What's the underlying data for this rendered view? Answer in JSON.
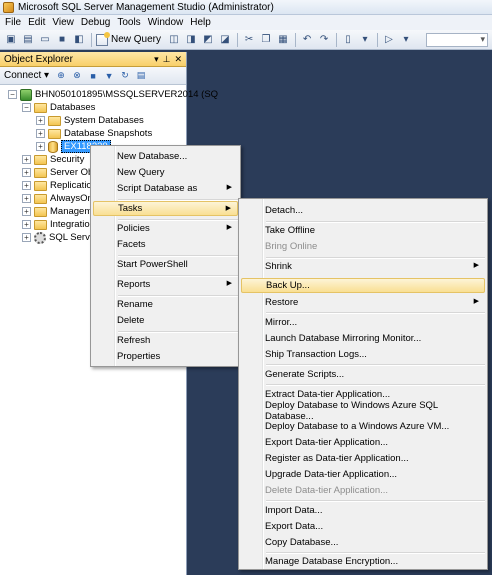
{
  "window": {
    "title": "Microsoft SQL Server Management Studio (Administrator)"
  },
  "menubar": {
    "items": [
      "File",
      "Edit",
      "View",
      "Debug",
      "Tools",
      "Window",
      "Help"
    ]
  },
  "toolbar": {
    "new_query_label": "New Query"
  },
  "object_explorer": {
    "title": "Object Explorer",
    "connect_label": "Connect ▾",
    "tree": {
      "server": "BHN050101895\\MSSQLSERVER2014 (SQ",
      "databases": "Databases",
      "system_databases": "System Databases",
      "database_snapshots": "Database Snapshots",
      "selected_db": "EX118230",
      "security": "Security",
      "server_objects": "Server Obje",
      "replication": "Replication",
      "alwayson": "AlwaysOn",
      "management": "Manageme",
      "integration": "Integration",
      "agent": "SQL Server"
    }
  },
  "context_menu": {
    "items": {
      "new_database": "New Database...",
      "new_query": "New Query",
      "script_database_as": "Script Database as",
      "tasks": "Tasks",
      "policies": "Policies",
      "facets": "Facets",
      "start_powershell": "Start PowerShell",
      "reports": "Reports",
      "rename": "Rename",
      "delete": "Delete",
      "refresh": "Refresh",
      "properties": "Properties"
    }
  },
  "tasks_submenu": {
    "items": {
      "detach": "Detach...",
      "take_offline": "Take Offline",
      "bring_online": "Bring Online",
      "shrink": "Shrink",
      "back_up": "Back Up...",
      "restore": "Restore",
      "mirror": "Mirror...",
      "launch_mirroring_monitor": "Launch Database Mirroring Monitor...",
      "ship_transaction_logs": "Ship Transaction Logs...",
      "generate_scripts": "Generate Scripts...",
      "extract_dac": "Extract Data-tier Application...",
      "deploy_azure_sql": "Deploy Database to Windows Azure SQL Database...",
      "deploy_azure_vm": "Deploy Database to a Windows Azure VM...",
      "export_dac": "Export Data-tier Application...",
      "register_dac": "Register as Data-tier Application...",
      "upgrade_dac": "Upgrade Data-tier Application...",
      "delete_dac": "Delete Data-tier Application...",
      "import_data": "Import Data...",
      "export_data": "Export Data...",
      "copy_database": "Copy Database...",
      "manage_encryption": "Manage Database Encryption..."
    }
  }
}
